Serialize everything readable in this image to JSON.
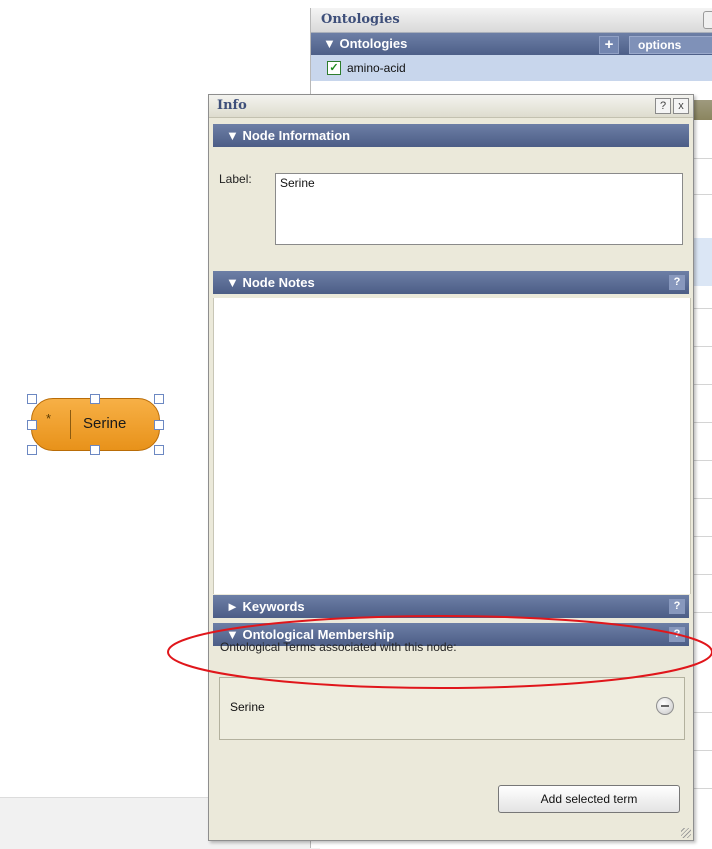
{
  "ontologies_panel": {
    "title": "Ontologies",
    "header": "▼ Ontologies",
    "add_label": "+",
    "options_label": "options",
    "items": [
      {
        "label": "amino-acid",
        "checked": true
      }
    ]
  },
  "info_dialog": {
    "title": "Info",
    "help_label": "?",
    "close_label": "x",
    "sections": {
      "node_information": "▼ Node Information",
      "node_notes": "▼ Node Notes",
      "keywords": "► Keywords",
      "ontological_membership": "▼ Ontological Membership"
    },
    "label_caption": "Label:",
    "label_value": "Serine",
    "membership_description": "Ontological Terms associated with this node:",
    "membership_terms": [
      "Serine"
    ],
    "add_button_label": "Add selected term"
  },
  "node": {
    "icon": "*",
    "label": "Serine"
  },
  "annotation": {
    "color": "#e0161b"
  }
}
